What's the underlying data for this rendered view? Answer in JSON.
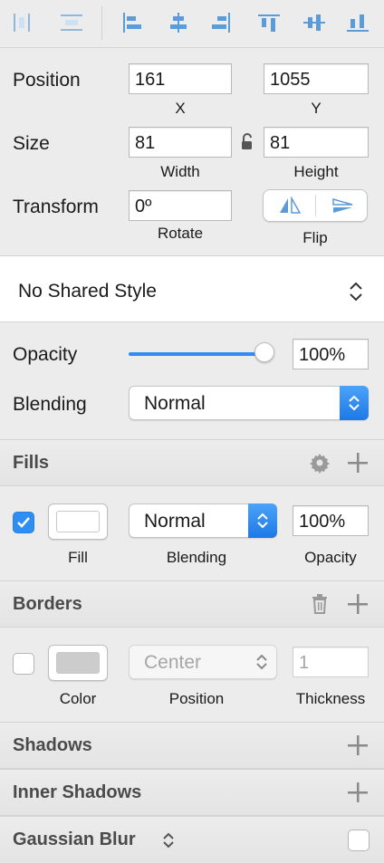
{
  "position": {
    "label": "Position",
    "x": "161",
    "x_label": "X",
    "y": "1055",
    "y_label": "Y"
  },
  "size": {
    "label": "Size",
    "width": "81",
    "width_label": "Width",
    "height": "81",
    "height_label": "Height"
  },
  "transform": {
    "label": "Transform",
    "rotate": "0º",
    "rotate_label": "Rotate",
    "flip_label": "Flip"
  },
  "shared_style": {
    "value": "No Shared Style"
  },
  "opacity": {
    "label": "Opacity",
    "value": "100%",
    "slider_fraction": 1.0
  },
  "blending": {
    "label": "Blending",
    "value": "Normal"
  },
  "fills": {
    "title": "Fills",
    "enabled": true,
    "fill_label": "Fill",
    "blending_value": "Normal",
    "blending_label": "Blending",
    "opacity_value": "100%",
    "opacity_label": "Opacity",
    "swatch_color": "#ffffff"
  },
  "borders": {
    "title": "Borders",
    "enabled": false,
    "color_label": "Color",
    "position_value": "Center",
    "position_label": "Position",
    "thickness_value": "1",
    "thickness_label": "Thickness",
    "swatch_color": "#cccccc"
  },
  "shadows": {
    "title": "Shadows"
  },
  "inner_shadows": {
    "title": "Inner Shadows"
  },
  "gaussian_blur": {
    "title": "Gaussian Blur",
    "enabled": false
  },
  "colors": {
    "accent": "#2e8ef3",
    "icon": "#5a9bd8",
    "muted_icon": "#9a9a9a"
  }
}
